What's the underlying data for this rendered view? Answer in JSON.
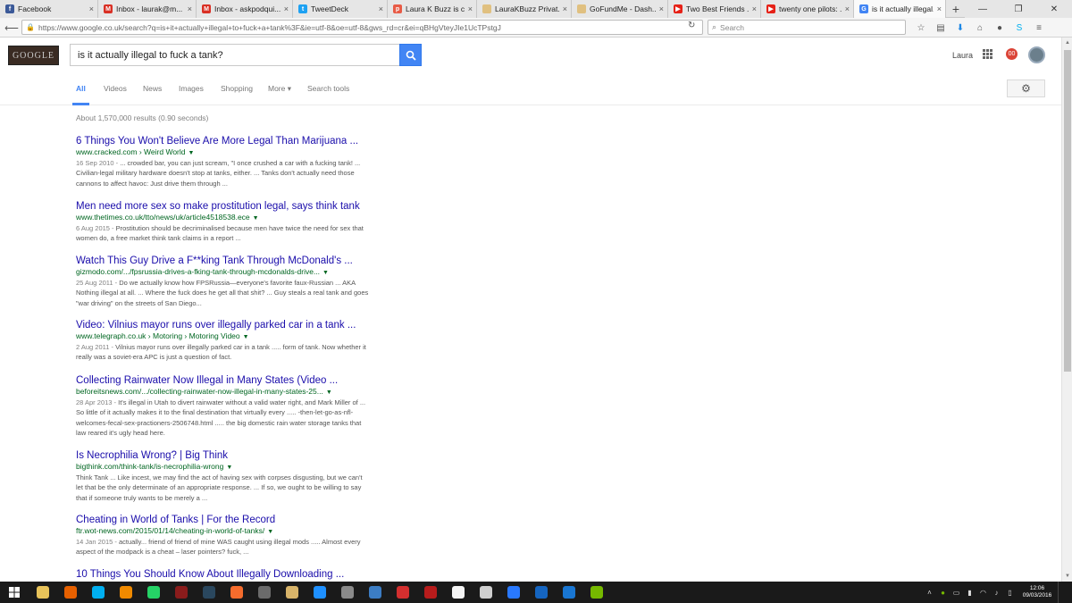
{
  "browser": {
    "tabs": [
      {
        "title": "Facebook",
        "icon": "facebook-icon",
        "color": "#3b5998",
        "glyph": "f"
      },
      {
        "title": "Inbox - laurak@m...",
        "icon": "gmail-icon",
        "color": "#d93025",
        "glyph": "M"
      },
      {
        "title": "Inbox - askpodqui...",
        "icon": "gmail-icon",
        "color": "#d93025",
        "glyph": "M"
      },
      {
        "title": "TweetDeck",
        "icon": "tweetdeck-icon",
        "color": "#1da1f2",
        "glyph": "t"
      },
      {
        "title": "Laura K Buzz is cre...",
        "icon": "patreon-icon",
        "color": "#e85b46",
        "glyph": "p"
      },
      {
        "title": "LauraKBuzz Privat...",
        "icon": "page-icon",
        "color": "#e0c080",
        "glyph": ""
      },
      {
        "title": "GoFundMe - Dash...",
        "icon": "page-icon",
        "color": "#e0c080",
        "glyph": ""
      },
      {
        "title": "Two Best Friends ...",
        "icon": "youtube-icon",
        "color": "#e62117",
        "glyph": "▶"
      },
      {
        "title": "twenty one pilots: ...",
        "icon": "youtube-icon",
        "color": "#e62117",
        "glyph": "▶"
      },
      {
        "title": "is it actually illegal...",
        "icon": "google-icon",
        "color": "#4285f4",
        "glyph": "G",
        "active": true
      }
    ],
    "url": "https://www.google.co.uk/search?q=is+it+actually+illegal+to+fuck+a+tank%3F&ie=utf-8&oe=utf-8&gws_rd=cr&ei=qBHgVteyJIe1UcTPstgJ",
    "search_placeholder": "Search"
  },
  "google": {
    "logo_text": "GOOGLE",
    "query": "is it actually illegal to fuck a tank?",
    "user_name": "Laura",
    "notification_count": "00",
    "tabs": [
      "All",
      "Videos",
      "News",
      "Images",
      "Shopping",
      "More ▾",
      "Search tools"
    ],
    "stats": "About 1,570,000 results (0.90 seconds)",
    "results": [
      {
        "title": "6 Things You Won't Believe Are More Legal Than Marijuana ...",
        "url": "www.cracked.com › Weird World",
        "date": "16 Sep 2010 - ",
        "snippet": "... crowded bar, you can just scream, \"I once crushed a car with a fucking tank! ... Civilian-legal military hardware doesn't stop at tanks, either. ... Tanks don't actually need those cannons to affect havoc: Just drive them through ..."
      },
      {
        "title": "Men need more sex so make prostitution legal, says think tank",
        "url": "www.thetimes.co.uk/tto/news/uk/article4518538.ece",
        "date": "6 Aug 2015 - ",
        "snippet": "Prostitution should be decriminalised because men have twice the need for sex that women do, a free market think tank claims in a report ..."
      },
      {
        "title": "Watch This Guy Drive a F**king Tank Through McDonald's ...",
        "url": "gizmodo.com/.../fpsrussia-drives-a-fking-tank-through-mcdonalds-drive...",
        "date": "25 Aug 2011 - ",
        "snippet": "Do we actually know how FPSRussia—everyone's favorite faux-Russian ... AKA Nothing illegal at all. ... Where the fuck does he get all that shit? ... Guy steals a real tank and goes \"war driving\" on the streets of San Diego..."
      },
      {
        "title": "Video: Vilnius mayor runs over illegally parked car in a tank ...",
        "url": "www.telegraph.co.uk › Motoring › Motoring Video",
        "date": "2 Aug 2011 - ",
        "snippet": "Vilnius mayor runs over illegally parked car in a tank ..... form of tank. Now whether it really was a soviet-era APC is just a question of fact."
      },
      {
        "title": "Collecting Rainwater Now Illegal in Many States (Video ...",
        "url": "beforeitsnews.com/.../collecting-rainwater-now-illegal-in-many-states-25...",
        "date": "28 Apr 2013 - ",
        "snippet": "It's illegal in Utah to divert rainwater without a valid water right, and Mark Miller of ... So little of it actually makes it to the final destination that virtually every ..... -then-let-go-as-nfl-welcomes-fecal-sex-practioners-2506748.html ..... the big domestic rain water storage tanks that law reared it's ugly head here."
      },
      {
        "title": "Is Necrophilia Wrong? | Big Think",
        "url": "bigthink.com/think-tank/is-necrophilia-wrong",
        "date": "",
        "snippet": "Think Tank ... Like incest, we may find the act of having sex with corpses disgusting, but we can't let that be the only determinate of an appropriate response. ... If so, we ought to be willing to say that if someone truly wants to be merely a ..."
      },
      {
        "title": "Cheating in World of Tanks | For the Record",
        "url": "ftr.wot-news.com/2015/01/14/cheating-in-world-of-tanks/",
        "date": "14 Jan 2015 - ",
        "snippet": "actually... friend of friend of mine WAS caught using illegal mods ..... Almost every aspect of the modpack is a cheat – laser pointers? fuck, ..."
      },
      {
        "title": "10 Things You Should Know About Illegally Downloading ...",
        "url": "",
        "date": "",
        "snippet": ""
      }
    ]
  },
  "taskbar": {
    "time": "12:06",
    "date": "09/03/2016",
    "apps": [
      {
        "name": "file-explorer-icon",
        "color": "#e8c35a"
      },
      {
        "name": "firefox-icon",
        "color": "#e66000"
      },
      {
        "name": "skype-icon",
        "color": "#00aff0"
      },
      {
        "name": "vlc-icon",
        "color": "#f08a00"
      },
      {
        "name": "whatsapp-icon",
        "color": "#25d366"
      },
      {
        "name": "game-icon",
        "color": "#8a1c1c"
      },
      {
        "name": "steam-icon",
        "color": "#2a475e"
      },
      {
        "name": "origin-icon",
        "color": "#f56c2d"
      },
      {
        "name": "app-icon",
        "color": "#6b6b6b"
      },
      {
        "name": "media-icon",
        "color": "#d8b46a"
      },
      {
        "name": "edge-icon",
        "color": "#1e90ff"
      },
      {
        "name": "app-icon",
        "color": "#8a8a8a"
      },
      {
        "name": "app-icon",
        "color": "#3c7dc4"
      },
      {
        "name": "record-icon",
        "color": "#d32f2f"
      },
      {
        "name": "app-icon",
        "color": "#b71c1c"
      },
      {
        "name": "app-icon",
        "color": "#f5f5f5"
      },
      {
        "name": "app-icon",
        "color": "#cfcfcf"
      },
      {
        "name": "mail-icon",
        "color": "#2979ff"
      },
      {
        "name": "monitor-icon",
        "color": "#1565c0"
      },
      {
        "name": "app-icon",
        "color": "#1976d2"
      },
      {
        "name": "nvidia-icon",
        "color": "#76b900"
      }
    ]
  }
}
